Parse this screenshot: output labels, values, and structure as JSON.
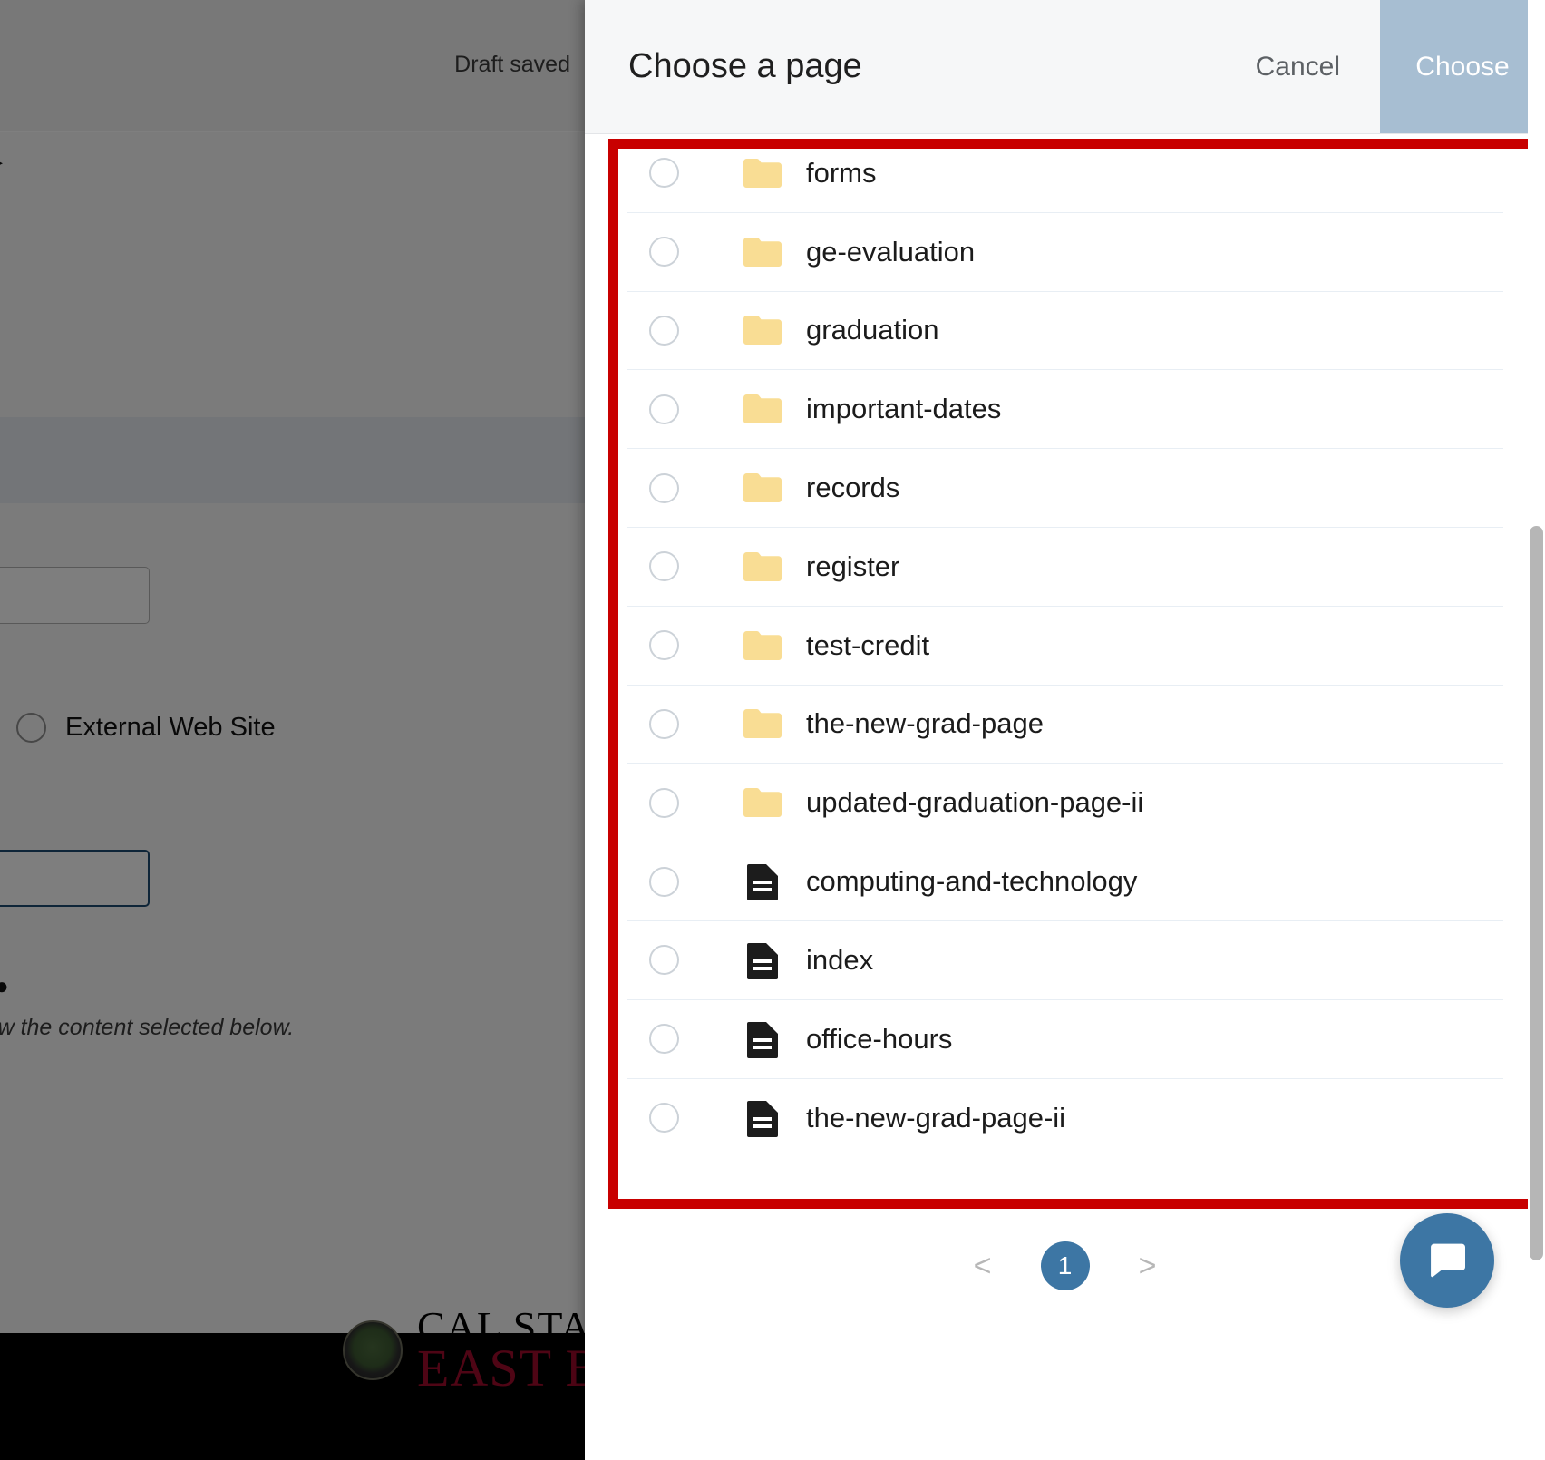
{
  "background_page": {
    "draft_status": "Draft saved",
    "radio_option_label": "External Web Site",
    "helper_note": "t will display below the content selected below.",
    "logo_line1": "CAL STATE",
    "logo_line2": "EAST BAY"
  },
  "modal": {
    "title": "Choose a page",
    "cancel_label": "Cancel",
    "choose_label": "Choose",
    "choose_button_color": "#a7bed2",
    "items": [
      {
        "label": "forms",
        "type": "folder"
      },
      {
        "label": "ge-evaluation",
        "type": "folder"
      },
      {
        "label": "graduation",
        "type": "folder"
      },
      {
        "label": "important-dates",
        "type": "folder"
      },
      {
        "label": "records",
        "type": "folder"
      },
      {
        "label": "register",
        "type": "folder"
      },
      {
        "label": "test-credit",
        "type": "folder"
      },
      {
        "label": "the-new-grad-page",
        "type": "folder"
      },
      {
        "label": "updated-graduation-page-ii",
        "type": "folder"
      },
      {
        "label": "computing-and-technology",
        "type": "file"
      },
      {
        "label": "index",
        "type": "file"
      },
      {
        "label": "office-hours",
        "type": "file"
      },
      {
        "label": "the-new-grad-page-ii",
        "type": "file"
      }
    ],
    "pagination": {
      "prev_label": "<",
      "current_page": "1",
      "next_label": ">"
    }
  },
  "annotation": {
    "highlight_color": "#c80000"
  },
  "chat": {
    "icon": "chat-bubble-icon",
    "color": "#3d76a4"
  },
  "colors": {
    "folder_icon": "#f9dd94",
    "file_icon": "#1c1c1c",
    "row_divider": "#e8eef4",
    "pager_active": "#3d76a4"
  }
}
